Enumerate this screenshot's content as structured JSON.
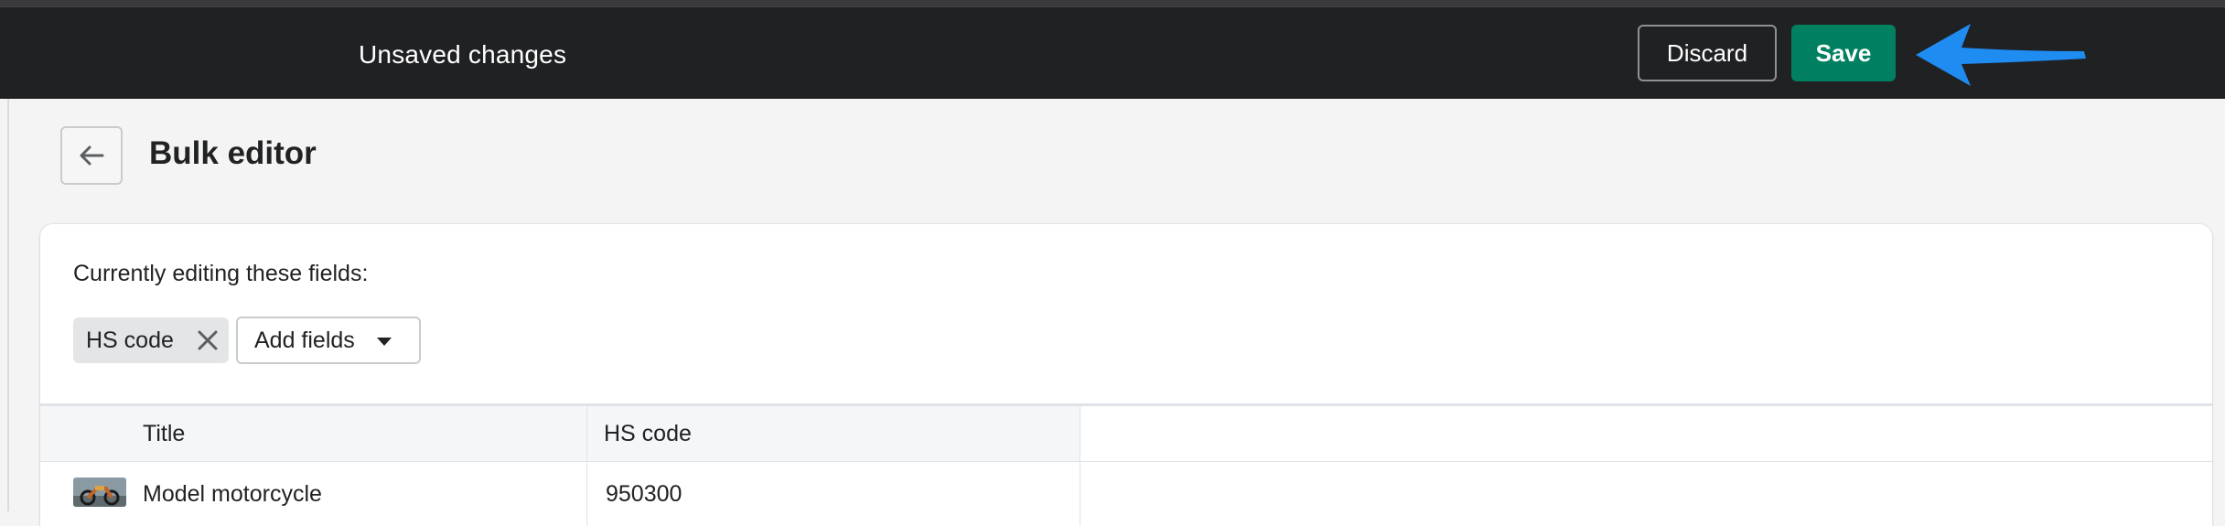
{
  "topbar": {
    "title": "Unsaved changes",
    "discard_label": "Discard",
    "save_label": "Save",
    "annotation_color": "#1e8cf0"
  },
  "page": {
    "title": "Bulk editor",
    "back_icon": "arrow-left-icon"
  },
  "editor": {
    "editing_label": "Currently editing these fields:",
    "fields": [
      {
        "label": "HS code",
        "remove_icon": "close-icon"
      }
    ],
    "add_fields_label": "Add fields"
  },
  "table": {
    "columns": [
      "Title",
      "HS code"
    ],
    "rows": [
      {
        "title": "Model motorcycle",
        "hs_code": "950300",
        "thumbnail_icon": "motorcycle-thumbnail"
      }
    ]
  },
  "colors": {
    "topbar_bg": "#202123",
    "save_bg": "#008060",
    "page_bg": "#f4f4f4"
  }
}
